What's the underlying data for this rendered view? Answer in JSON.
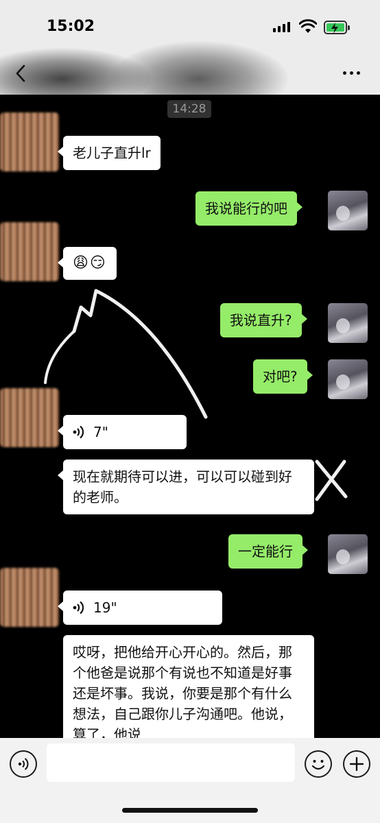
{
  "status_bar": {
    "time": "15:02",
    "icons": [
      "cellular-signal-icon",
      "wifi-icon",
      "battery-charging-icon"
    ]
  },
  "nav": {
    "title": "",
    "back_icon": "chevron-left-icon",
    "more_icon": "more-dots-icon"
  },
  "chat": {
    "timestamp": "14:28",
    "messages": [
      {
        "side": "left",
        "type": "text",
        "text": "老儿子直升lr"
      },
      {
        "side": "right",
        "type": "text",
        "text": "我说能行的吧"
      },
      {
        "side": "left",
        "type": "emoji",
        "text": "😩😏"
      },
      {
        "side": "right",
        "type": "text",
        "text": "我说直升?"
      },
      {
        "side": "right",
        "type": "text",
        "text": "对吧?"
      },
      {
        "side": "left",
        "type": "voice",
        "duration": "7\""
      },
      {
        "side": "left",
        "type": "text",
        "text": "现在就期待可以进，可以可以碰到好的老师。"
      },
      {
        "side": "right",
        "type": "text",
        "text": "一定能行"
      },
      {
        "side": "left",
        "type": "voice",
        "duration": "19\""
      },
      {
        "side": "left",
        "type": "text",
        "text": "哎呀，把他给开心开心的。然后，那个他爸是说那个有说也不知道是好事还是坏事。我说，你要是那个有什么想法，自己跟你儿子沟通吧。他说，算了，他说"
      }
    ]
  },
  "input_bar": {
    "voice_icon": "voice-input-icon",
    "emoji_icon": "emoji-icon",
    "plus_icon": "plus-icon",
    "placeholder": ""
  },
  "colors": {
    "outgoing_bubble": "#95ec69",
    "incoming_bubble": "#ffffff",
    "chat_background": "#000000",
    "bar_background": "#ececec"
  }
}
